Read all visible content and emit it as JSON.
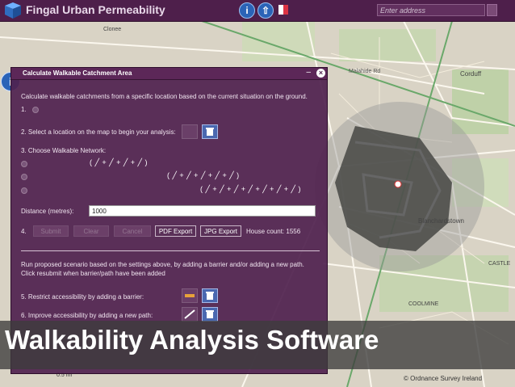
{
  "app": {
    "title": "Fingal Urban Permeability"
  },
  "search": {
    "placeholder": "Enter address"
  },
  "colors": {
    "header": "#4e1f4b",
    "panel": "#4f214e",
    "accent_button": "#4a68b0"
  },
  "panel": {
    "title": "Calculate Walkable Catchment Area",
    "intro": "Calculate walkable catchments from a specific location based on the current situation on the ground.",
    "step1": "1.",
    "step2": "2. Select a location on the map to begin your analysis:",
    "step3": "3. Choose Walkable Network:",
    "network_options": [
      {
        "symbols": "( ╱ + ╱ + ╱ + ╱ )"
      },
      {
        "symbols": "( ╱ + ╱ + ╱ + ╱ + ╱ )"
      },
      {
        "symbols": "( ╱ + ╱ + ╱ + ╱ + ╱ + ╱ + ╱ )"
      }
    ],
    "distance_label": "Distance (metres):",
    "distance_value": "1000",
    "step4": "4.",
    "buttons": {
      "submit": "Submit",
      "clear": "Clear",
      "cancel": "Cancel",
      "pdf": "PDF Export",
      "jpg": "JPG Export"
    },
    "house_count": "House count: 1556",
    "proposed_text_1": "Run proposed scenario based on the settings above, by adding a barrier and/or adding a new path.",
    "proposed_text_2": "Click resubmit when barrier/path have been added",
    "step5": "5. Restrict accessibility by adding a barrier:",
    "step6": "6. Improve accessibility by adding a new path:"
  },
  "map": {
    "labels": [
      "Malahide Rd",
      "Blanchardstown",
      "CASTLE",
      "COOLMINE",
      "Corduff",
      "Clonee"
    ],
    "scale": "0.5 mi",
    "attribution": "© Ordnance Survey Ireland"
  },
  "caption": "Walkability Analysis Software"
}
